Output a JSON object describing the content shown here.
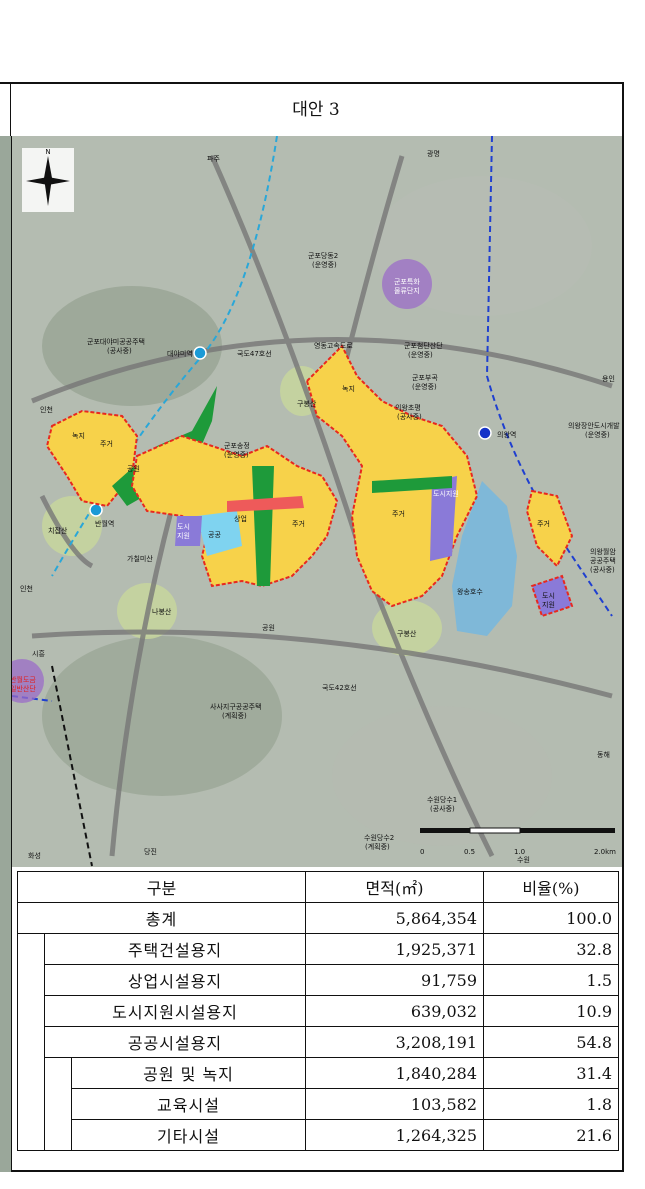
{
  "title": "대안 3",
  "map": {
    "north": "N",
    "places": {
      "paju": "파주",
      "gwangmyeong": "광명",
      "gunpo_dangdong2": "군포당동2",
      "gunpo_dangdong2_sub": "(운영중)",
      "gunpo_special": "군포특화",
      "gunpo_special2": "물류단지",
      "gunpo_daeya": "군포대야미공공주택",
      "gunpo_daeya_sub": "(공사중)",
      "daeyami_st": "대야미역",
      "route47": "국도47호선",
      "yeongdong": "영동고속도로",
      "gunpo_cheomdan": "군포첨단산단",
      "gunpo_cheomdan_sub": "(운영중)",
      "gunpo_bugok": "군포부곡",
      "gunpo_bugok_sub": "(운영중)",
      "uiwang_chonjeong": "의왕초평",
      "uiwang_chonjeong_sub": "(공사중)",
      "uiwang_st": "의왕역",
      "uiwang_jangan": "의왕장안도시개발",
      "uiwang_jangan_sub": "(운영중)",
      "yongin": "용인",
      "incheon": "인천",
      "guryongsan": "구봉산",
      "gunpo_songjeong": "군포송정",
      "gunpo_songjeong_sub": "(운영중)",
      "banwol_st": "반월역",
      "chirabsan": "치잡산",
      "gachilisan": "가칠미산",
      "incheon2": "인천",
      "nabongsan": "나봉산",
      "wangsong_lake": "왕송호수",
      "gubongsan2": "구봉산",
      "uiwang_wolam": "의왕월암",
      "uiwang_wolam2": "공공주택",
      "uiwang_wolam_sub": "(공사중)",
      "siheung": "시흥",
      "banwol_dogeum": "반월도금",
      "banwol_dogeum2": "일반산단",
      "route42": "국도42호선",
      "sasa": "사사지구공공주택",
      "sasa_sub": "(계획중)",
      "donghae": "동해",
      "suwon_dangsu1": "수원당수1",
      "suwon_dangsu1_sub": "(공사중)",
      "suwon_dangsu2": "수원당수2",
      "suwon_dangsu2_sub": "(계획중)",
      "dangjin": "당진",
      "hwaseong": "화성",
      "suwon": "수원"
    },
    "zones": {
      "residential": "주거",
      "park": "공원",
      "public": "공공",
      "green": "녹지",
      "commercial": "상업",
      "urban_support": "도시지원",
      "urban1": "도시",
      "urban2": "지원"
    },
    "scale": {
      "s0": "0",
      "s05": "0.5",
      "s1": "1.0",
      "s2": "2.0km"
    }
  },
  "table": {
    "headers": [
      "구분",
      "면적(㎡)",
      "비율(%)"
    ],
    "rows": [
      {
        "label": "총계",
        "area": "5,864,354",
        "ratio": "100.0"
      },
      {
        "label": "주택건설용지",
        "area": "1,925,371",
        "ratio": "32.8"
      },
      {
        "label": "상업시설용지",
        "area": "91,759",
        "ratio": "1.5"
      },
      {
        "label": "도시지원시설용지",
        "area": "639,032",
        "ratio": "10.9"
      },
      {
        "label": "공공시설용지",
        "area": "3,208,191",
        "ratio": "54.8"
      },
      {
        "label": "공원 및 녹지",
        "area": "1,840,284",
        "ratio": "31.4"
      },
      {
        "label": "교육시설",
        "area": "103,582",
        "ratio": "1.8"
      },
      {
        "label": "기타시설",
        "area": "1,264,325",
        "ratio": "21.6"
      }
    ]
  },
  "colors": {
    "residential": "#f7d24a",
    "park": "#1e9a3a",
    "public": "#7fd3f0",
    "support": "#8a7ad8",
    "commercial": "#ee5a5a",
    "boundary": "#e8281e"
  }
}
